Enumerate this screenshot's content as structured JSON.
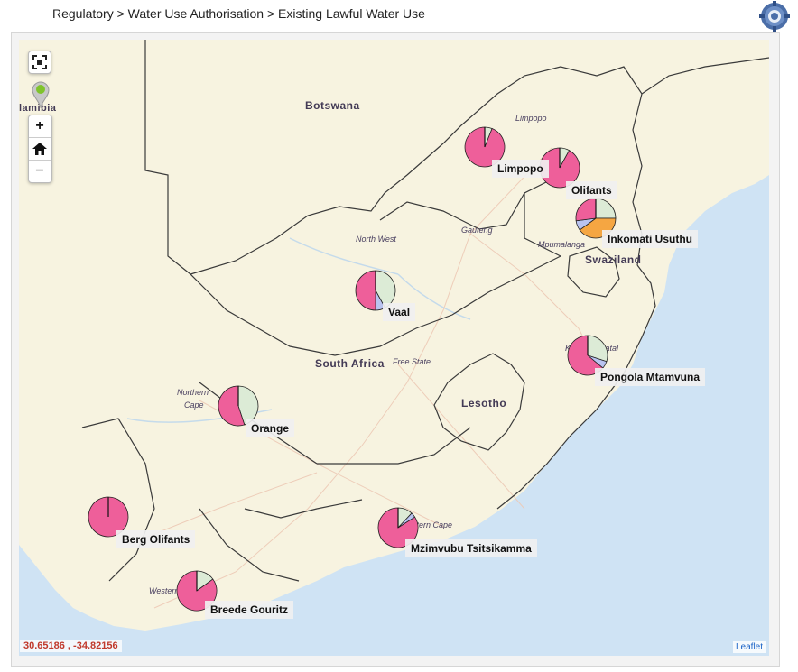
{
  "breadcrumb": "Regulatory > Water Use Authorisation > Existing Lawful Water Use",
  "controls": {
    "fullscreen_icon": "fullscreen-icon",
    "marker_icon": "location-marker-icon",
    "zoom_in": "+",
    "zoom_out": "−",
    "home_icon": "home-icon"
  },
  "map": {
    "coordinates": "30.65186 , -34.82156",
    "attribution": "Leaflet",
    "places": {
      "botswana": "Botswana",
      "namibia": "lamibia",
      "south_africa": "South Africa",
      "lesotho": "Lesotho",
      "swaziland": "Swaziland"
    },
    "regions": {
      "limpopo": "Limpopo",
      "north_west": "North West",
      "gauteng": "Gauteng",
      "mpumalanga": "Mpumalanga",
      "free_state": "Free State",
      "northern_cape_1": "Northern",
      "northern_cape_2": "Cape",
      "kwazulu_natal": "KwaZulu-Natal",
      "eastern_cape": "Eastern Cape",
      "western_cape": "Western Cape"
    },
    "colors": {
      "land": "#f7f3e0",
      "sea": "#cfe3f4",
      "pie_green": "#dcebd6",
      "pie_pink": "#ee5f9a",
      "pie_blue": "#b9c3f0",
      "pie_orange": "#f5a642"
    },
    "wma": [
      {
        "name": "Limpopo",
        "slices": [
          0.06,
          0.94
        ]
      },
      {
        "name": "Olifants",
        "slices": [
          0.08,
          0.92
        ]
      },
      {
        "name": "Inkomati Usuthu",
        "slices": [
          0.25,
          0.4,
          0.08,
          0.27
        ]
      },
      {
        "name": "Vaal",
        "slices": [
          0.42,
          0.08,
          0.5
        ]
      },
      {
        "name": "Pongola Mtamvuna",
        "slices": [
          0.3,
          0.06,
          0.64
        ]
      },
      {
        "name": "Orange",
        "slices": [
          0.45,
          0.55
        ]
      },
      {
        "name": "Berg Olifants",
        "slices": [
          0.0,
          1.0
        ]
      },
      {
        "name": "Mzimvubu Tsitsikamma",
        "slices": [
          0.12,
          0.04,
          0.84
        ]
      },
      {
        "name": "Breede Gouritz",
        "slices": [
          0.15,
          0.85
        ]
      }
    ]
  }
}
